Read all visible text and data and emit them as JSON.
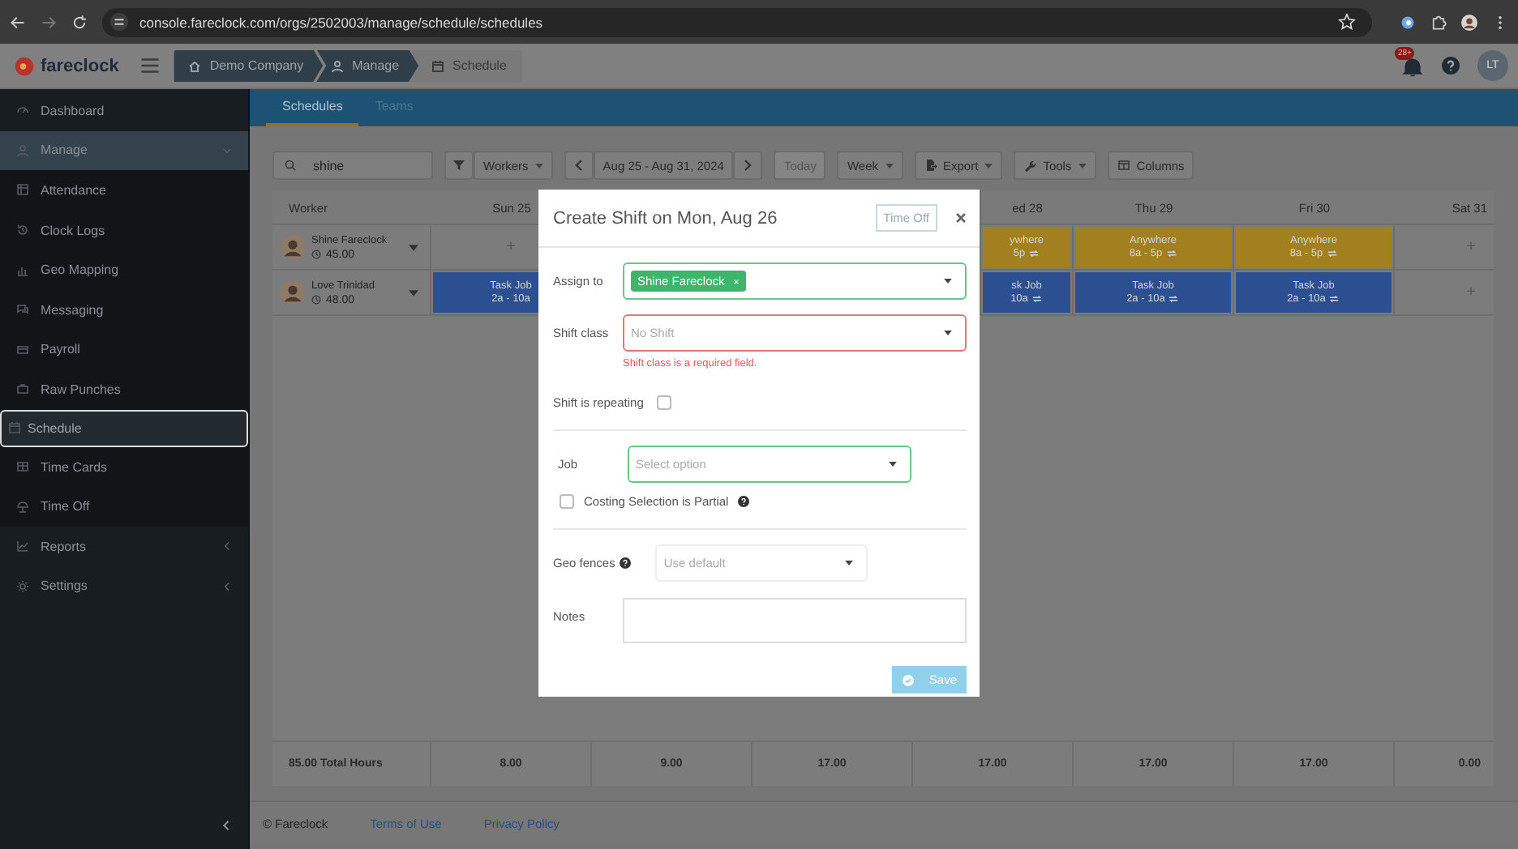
{
  "browser": {
    "url": "console.fareclock.com/orgs/2502003/manage/schedule/schedules"
  },
  "header": {
    "logo": "fareclock",
    "breadcrumb": [
      "Demo Company",
      "Manage",
      "Schedule"
    ],
    "notifications": "28+",
    "user_initials": "LT"
  },
  "sidebar": {
    "items": [
      {
        "label": "Dashboard",
        "selected": false
      },
      {
        "label": "Manage",
        "selected": false,
        "expanded": true,
        "children": [
          {
            "label": "Attendance",
            "selected": false
          },
          {
            "label": "Clock Logs",
            "selected": false
          },
          {
            "label": "Geo Mapping",
            "selected": false
          },
          {
            "label": "Messaging",
            "selected": false
          },
          {
            "label": "Payroll",
            "selected": false
          },
          {
            "label": "Raw Punches",
            "selected": false
          },
          {
            "label": "Schedule",
            "selected": true
          },
          {
            "label": "Time Cards",
            "selected": false
          },
          {
            "label": "Time Off",
            "selected": false
          }
        ]
      },
      {
        "label": "Reports",
        "selected": false,
        "expanded": false
      },
      {
        "label": "Settings",
        "selected": false,
        "expanded": false
      }
    ]
  },
  "tabs": [
    {
      "label": "Schedules",
      "selected": true
    },
    {
      "label": "Teams",
      "selected": false
    }
  ],
  "toolbar": {
    "search": {
      "value": "shine"
    },
    "filter": "Workers",
    "range": "Aug 25 - Aug 31, 2024",
    "today": {
      "label": "Today",
      "disabled": true
    },
    "view": "Week",
    "export": "Export",
    "tools": "Tools",
    "columns": "Columns"
  },
  "table": {
    "worker_header": "Worker",
    "columns": [
      "Sun 25",
      "ed 28",
      "Thu 29",
      "Fri 30",
      "Sat 31"
    ],
    "rows": [
      {
        "name": "Shine Fareclock",
        "hours": "45.00",
        "cells": [
          {
            "kind": "add",
            "text": "+"
          },
          {
            "kind": "shift",
            "title": "ywhere",
            "time": "5p",
            "repeating": true,
            "color": "#a3801f"
          },
          {
            "kind": "shift",
            "title": "Anywhere",
            "time": "8a - 5p",
            "repeating": true,
            "color": "#a3801f"
          },
          {
            "kind": "shift",
            "title": "Anywhere",
            "time": "8a - 5p",
            "repeating": true,
            "color": "#a3801f"
          },
          {
            "kind": "add",
            "text": "+"
          }
        ]
      },
      {
        "name": "Love Trinidad",
        "hours": "48.00",
        "cells": [
          {
            "kind": "shift",
            "title": "Task Job",
            "time": "2a - 10a",
            "repeating": false,
            "color": "#2c4f92"
          },
          {
            "kind": "shift",
            "title": "sk Job",
            "time": "10a",
            "repeating": true,
            "color": "#2c4f92"
          },
          {
            "kind": "shift",
            "title": "Task Job",
            "time": "2a - 10a",
            "repeating": true,
            "color": "#2c4f92"
          },
          {
            "kind": "shift",
            "title": "Task Job",
            "time": "2a - 10a",
            "repeating": true,
            "color": "#2c4f92"
          },
          {
            "kind": "add",
            "text": "+"
          }
        ]
      }
    ],
    "totals": [
      "85.00 Total Hours",
      "8.00",
      "9.00",
      "17.00",
      "17.00",
      "17.00",
      "17.00",
      "0.00"
    ]
  },
  "dialog": {
    "title": "Create Shift on Mon, Aug 26",
    "time_off": "Time Off",
    "assign_to": {
      "label": "Assign to",
      "valid": true,
      "invalid": false,
      "chips": [
        "Shine Fareclock"
      ]
    },
    "shift_class": {
      "label": "Shift class",
      "invalid": true,
      "placeholder": "No Shift",
      "error": "Shift class is a required field."
    },
    "repeating": {
      "label": "Shift is repeating",
      "checked": false
    },
    "job": {
      "label": "Job",
      "valid": true,
      "invalid": false,
      "placeholder": "Select option"
    },
    "costing_partial": {
      "label": "Costing Selection is Partial",
      "checked": false
    },
    "geo_fences": {
      "label": "Geo fences",
      "valid": false,
      "invalid": false,
      "placeholder": "Use default"
    },
    "notes": {
      "label": "Notes"
    },
    "save": {
      "label": "Save",
      "disabled": true
    }
  },
  "footer": {
    "copyright": "© Fareclock",
    "links": [
      "Terms of Use",
      "Privacy Policy"
    ]
  }
}
